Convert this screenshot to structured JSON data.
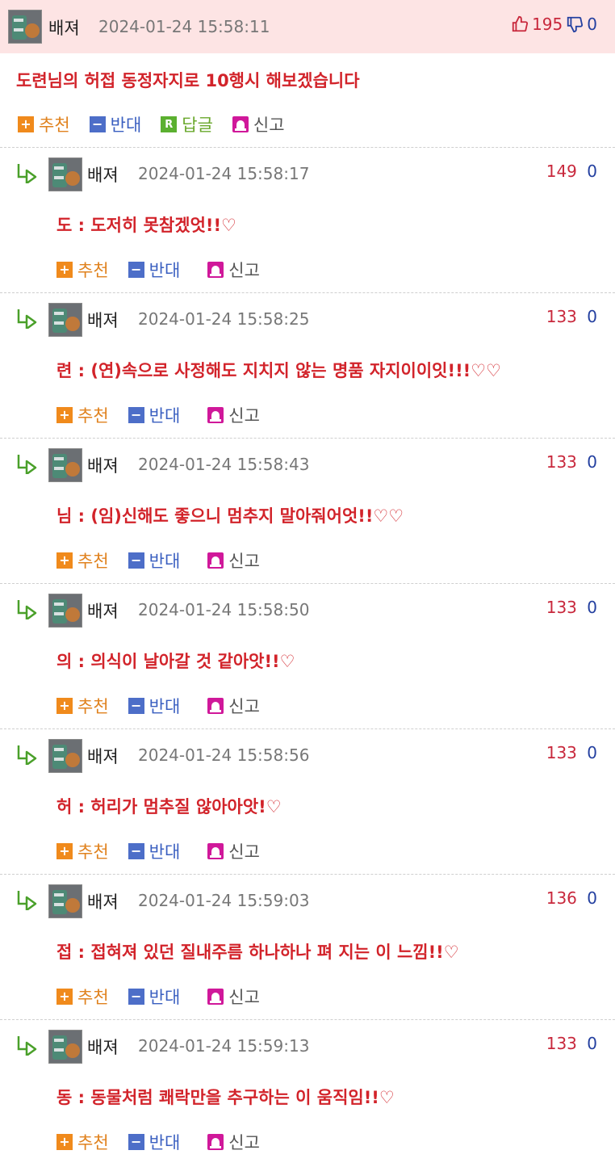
{
  "main_post": {
    "nickname": "배져",
    "timestamp": "2024-01-24 15:58:11",
    "upvotes": "195",
    "downvotes": "0",
    "text": "도련님의 허접 동정자지로 10행시 해보겠습니다",
    "actions": {
      "recommend": "추천",
      "oppose": "반대",
      "reply_badge": "R",
      "reply": "답글",
      "report": "신고"
    }
  },
  "comment_actions": {
    "recommend": "추천",
    "oppose": "반대",
    "report": "신고"
  },
  "colors": {
    "header_bg": "#fde4e4",
    "text_red": "#d2232a",
    "upvote": "#c8283c",
    "downvote": "#2440a0"
  },
  "replies": [
    {
      "nickname": "배져",
      "timestamp": "2024-01-24 15:58:17",
      "upvotes": "149",
      "downvotes": "0",
      "text": "도 : 도저히 못참겠엇!!♡"
    },
    {
      "nickname": "배져",
      "timestamp": "2024-01-24 15:58:25",
      "upvotes": "133",
      "downvotes": "0",
      "text": "련 : (연)속으로 사정해도 지치지 않는 명품 자지이이잇!!!♡♡"
    },
    {
      "nickname": "배져",
      "timestamp": "2024-01-24 15:58:43",
      "upvotes": "133",
      "downvotes": "0",
      "text": "님 : (임)신해도 좋으니 멈추지 말아줘어엇!!♡♡"
    },
    {
      "nickname": "배져",
      "timestamp": "2024-01-24 15:58:50",
      "upvotes": "133",
      "downvotes": "0",
      "text": "의 : 의식이 날아갈 것 같아앗!!♡"
    },
    {
      "nickname": "배져",
      "timestamp": "2024-01-24 15:58:56",
      "upvotes": "133",
      "downvotes": "0",
      "text": "허 : 허리가 멈추질 않아아앗!♡"
    },
    {
      "nickname": "배져",
      "timestamp": "2024-01-24 15:59:03",
      "upvotes": "136",
      "downvotes": "0",
      "text": "접 : 접혀져 있던 질내주름 하나하나 펴 지는 이 느낌!!♡"
    },
    {
      "nickname": "배져",
      "timestamp": "2024-01-24 15:59:13",
      "upvotes": "133",
      "downvotes": "0",
      "text": "동 : 동물처럼 쾌락만을 추구하는 이 움직임!!♡"
    }
  ]
}
